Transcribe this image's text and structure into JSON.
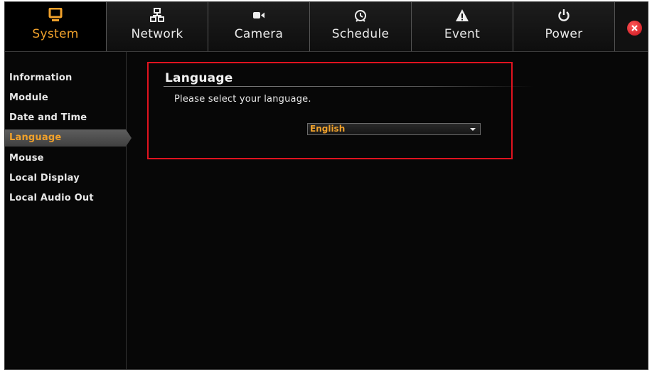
{
  "topnav": {
    "tabs": [
      {
        "label": "System",
        "icon": "monitor-icon"
      },
      {
        "label": "Network",
        "icon": "network-icon"
      },
      {
        "label": "Camera",
        "icon": "camera-icon"
      },
      {
        "label": "Schedule",
        "icon": "alarm-clock-icon"
      },
      {
        "label": "Event",
        "icon": "warning-icon"
      },
      {
        "label": "Power",
        "icon": "power-icon"
      }
    ],
    "active_tab": "System",
    "close_icon": "close-icon"
  },
  "sidebar": {
    "items": [
      {
        "label": "Information"
      },
      {
        "label": "Module"
      },
      {
        "label": "Date and Time"
      },
      {
        "label": "Language"
      },
      {
        "label": "Mouse"
      },
      {
        "label": "Local Display"
      },
      {
        "label": "Local Audio Out"
      }
    ],
    "active_item": "Language"
  },
  "main": {
    "section_title": "Language",
    "prompt": "Please select your language.",
    "language_select": {
      "value": "English"
    }
  },
  "colors": {
    "accent": "#f0a12b",
    "highlight_border": "#e0131f",
    "background": "#070707"
  }
}
